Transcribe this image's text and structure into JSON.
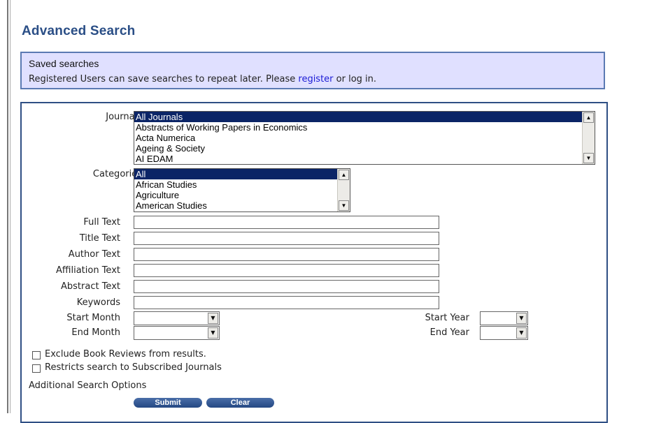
{
  "page": {
    "title": "Advanced Search"
  },
  "saved": {
    "heading": "Saved searches",
    "text_before": "Registered Users can save searches to repeat later. Please ",
    "register_link": "register",
    "text_after": " or log in."
  },
  "form": {
    "journals_label": "Journals",
    "journals": [
      "All Journals",
      "Abstracts of Working Papers in Economics",
      "Acta Numerica",
      "Ageing & Society",
      "AI EDAM"
    ],
    "categories_label": "Categories",
    "categories": [
      "All",
      "African Studies",
      "Agriculture",
      "American Studies"
    ],
    "full_text_label": "Full Text",
    "title_text_label": "Title Text",
    "author_text_label": "Author Text",
    "affiliation_text_label": "Affiliation Text",
    "abstract_text_label": "Abstract Text",
    "keywords_label": "Keywords",
    "start_month_label": "Start Month",
    "end_month_label": "End Month",
    "start_year_label": "Start Year",
    "end_year_label": "End Year",
    "exclude_reviews_label": "Exclude Book Reviews from results.",
    "subscribed_label": "Restricts search to Subscribed Journals",
    "additional_options_link": "Additional Search Options",
    "submit_label": "Submit",
    "clear_label": "Clear"
  }
}
